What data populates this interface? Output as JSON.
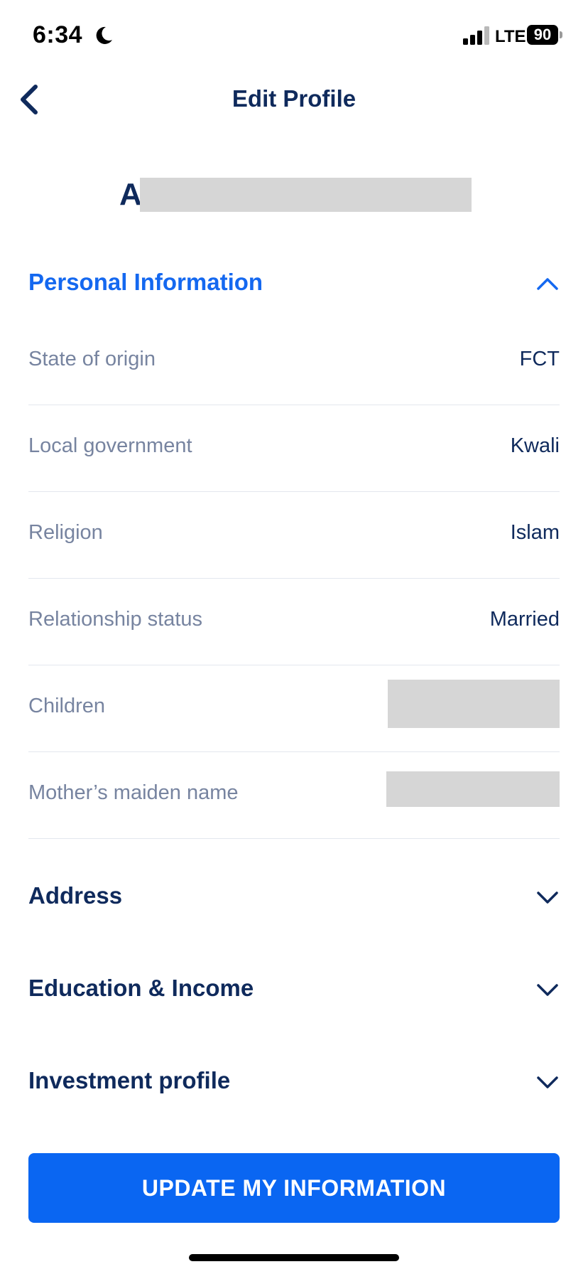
{
  "status_bar": {
    "time": "6:34",
    "network": "LTE",
    "battery": "90"
  },
  "nav": {
    "title": "Edit Profile"
  },
  "profile": {
    "name_initial": "A"
  },
  "sections": {
    "personal": {
      "title": "Personal Information",
      "expanded": true,
      "rows": [
        {
          "label": "State of origin",
          "value": "FCT"
        },
        {
          "label": "Local government",
          "value": "Kwali"
        },
        {
          "label": "Religion",
          "value": "Islam"
        },
        {
          "label": "Relationship status",
          "value": "Married"
        },
        {
          "label": "Children",
          "value": ""
        },
        {
          "label": "Mother’s maiden name",
          "value": ""
        }
      ]
    },
    "address": {
      "title": "Address",
      "expanded": false
    },
    "education": {
      "title": "Education & Income",
      "expanded": false
    },
    "investment": {
      "title": "Investment profile",
      "expanded": false
    }
  },
  "actions": {
    "update_label": "UPDATE MY INFORMATION"
  },
  "colors": {
    "primary": "#0a66f2",
    "active_section": "#1468f0",
    "heading": "#0f2a5c",
    "muted_label": "#7784a0",
    "divider": "#e3e7ee",
    "redaction": "#d6d6d6"
  }
}
